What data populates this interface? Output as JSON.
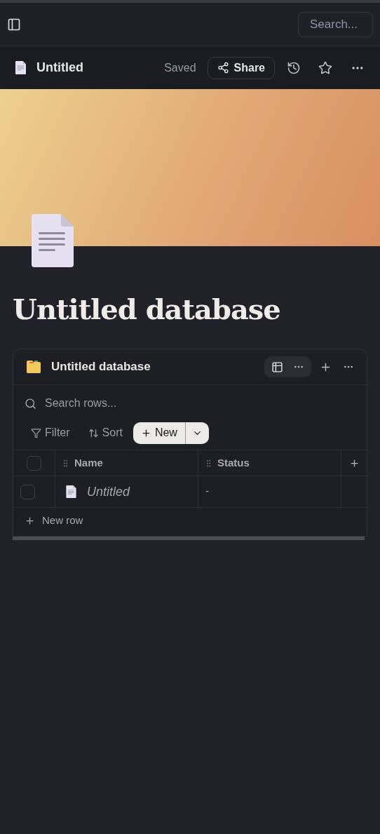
{
  "topbar": {
    "search": {
      "placeholder": "Search..."
    }
  },
  "page_header": {
    "title": "Untitled",
    "status": "Saved",
    "share_label": "Share"
  },
  "page": {
    "title": "Untitled database"
  },
  "database": {
    "title": "Untitled database",
    "search": {
      "placeholder": "Search rows..."
    },
    "filter": "Filter",
    "sort": "Sort",
    "new": "New",
    "columns": [
      {
        "name": "Name"
      },
      {
        "name": "Status"
      }
    ],
    "header_checkbox": {
      "checked": false
    },
    "rows": [
      {
        "checked": false,
        "name": "Untitled",
        "status": "-"
      }
    ],
    "new_row": "New row"
  }
}
